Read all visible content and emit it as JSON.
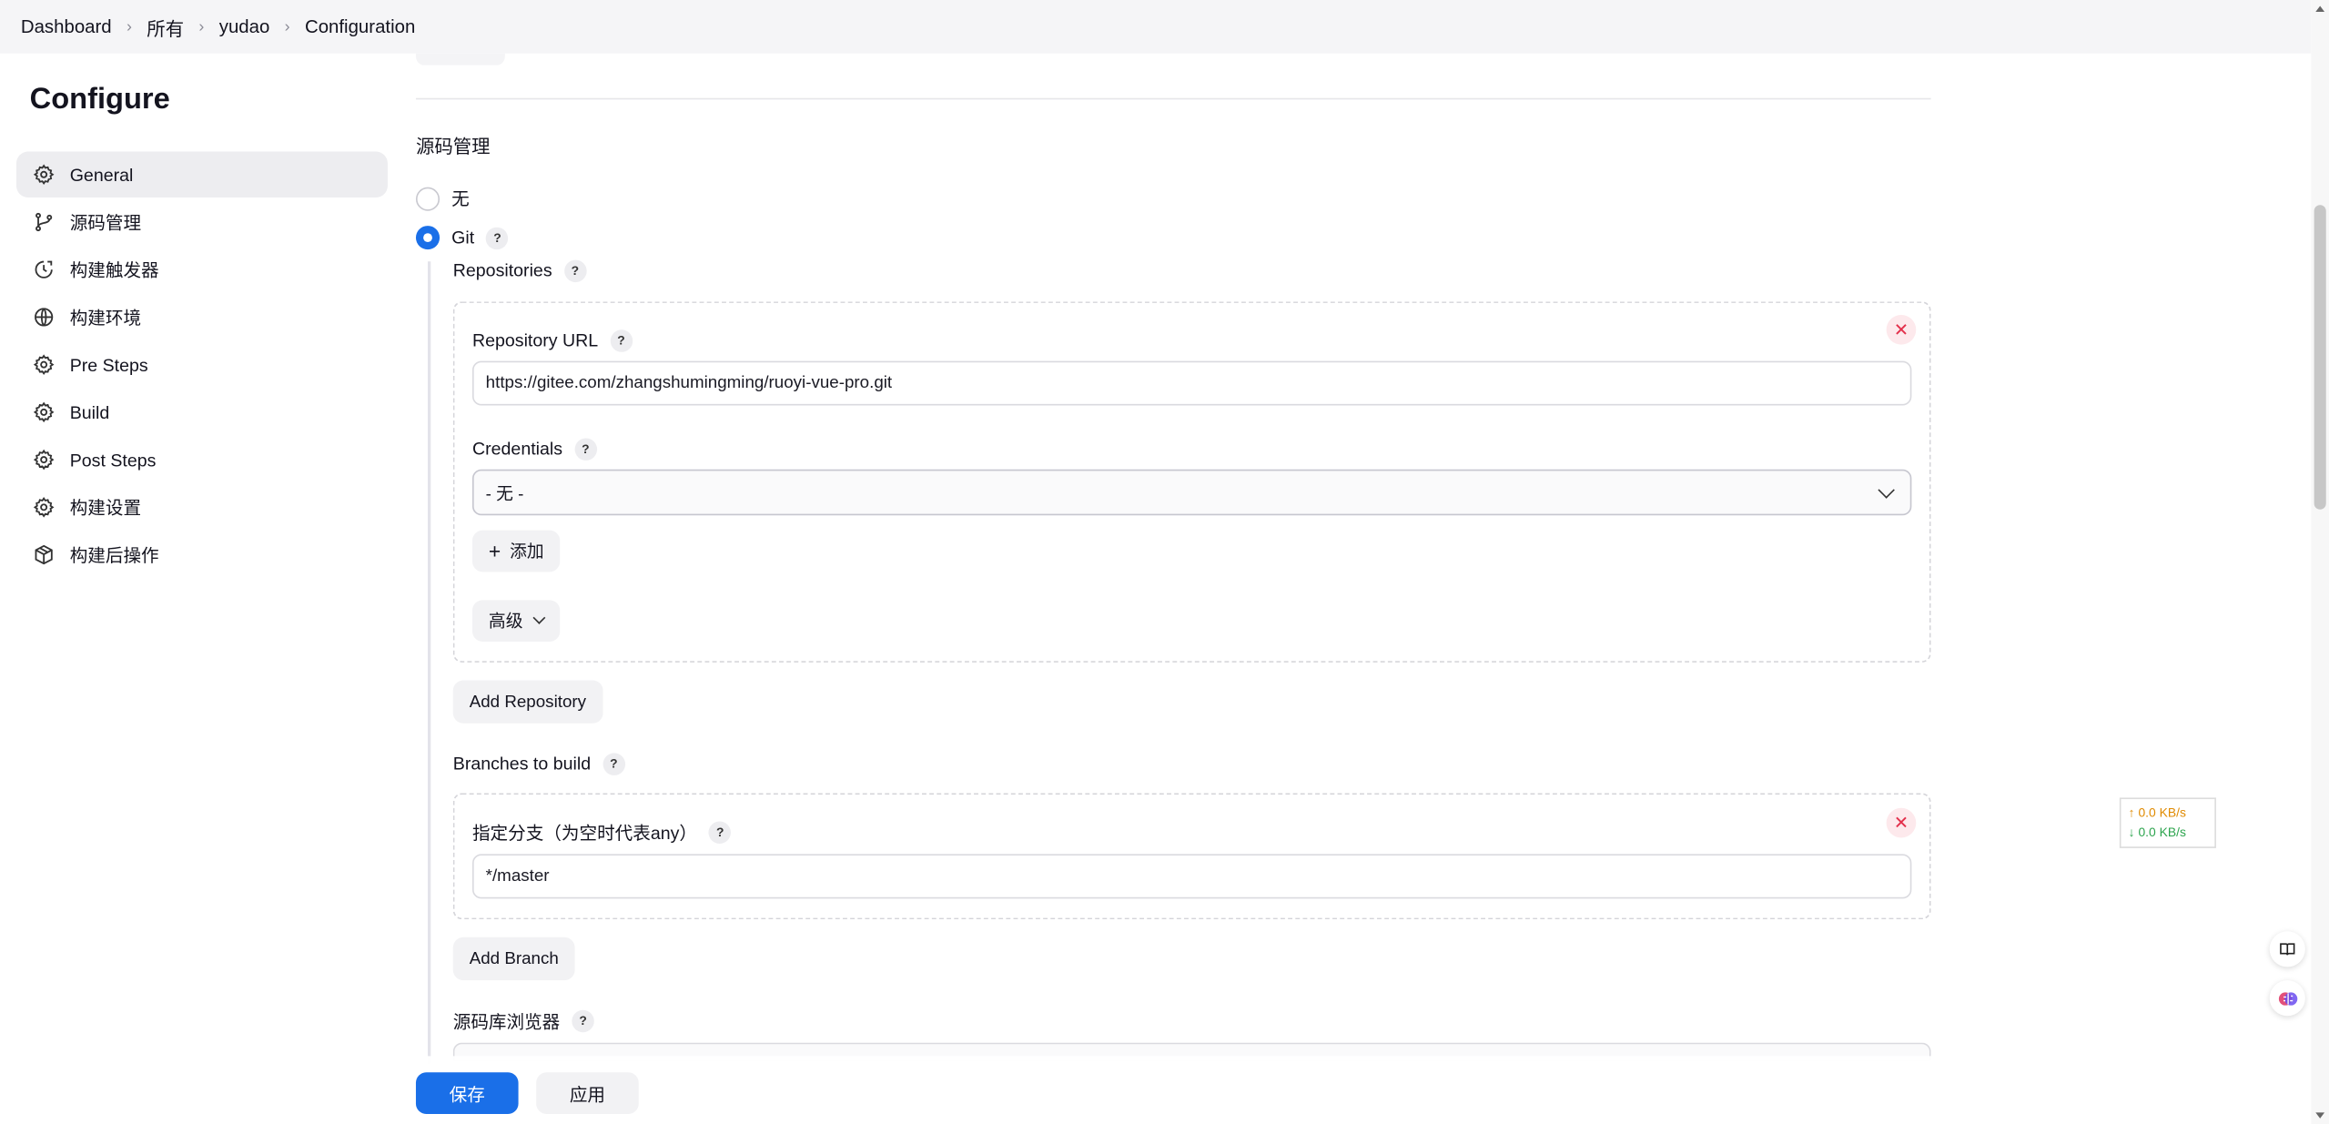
{
  "breadcrumb": [
    "Dashboard",
    "所有",
    "yudao",
    "Configuration"
  ],
  "page_title": "Configure",
  "sidebar": {
    "items": [
      {
        "label": "General",
        "icon": "gear-icon",
        "active": true
      },
      {
        "label": "源码管理",
        "icon": "git-branch-icon",
        "active": false
      },
      {
        "label": "构建触发器",
        "icon": "clock-icon",
        "active": false
      },
      {
        "label": "构建环境",
        "icon": "globe-icon",
        "active": false
      },
      {
        "label": "Pre Steps",
        "icon": "gear-icon",
        "active": false
      },
      {
        "label": "Build",
        "icon": "gear-icon",
        "active": false
      },
      {
        "label": "Post Steps",
        "icon": "gear-icon",
        "active": false
      },
      {
        "label": "构建设置",
        "icon": "gear-icon",
        "active": false
      },
      {
        "label": "构建后操作",
        "icon": "package-icon",
        "active": false
      }
    ]
  },
  "scm": {
    "section_title": "源码管理",
    "options": [
      {
        "label": "无",
        "checked": false
      },
      {
        "label": "Git",
        "checked": true
      }
    ],
    "help_mark": "?",
    "repositories_label": "Repositories",
    "repository": {
      "url_label": "Repository URL",
      "url_value": "https://gitee.com/zhangshumingming/ruoyi-vue-pro.git",
      "credentials_label": "Credentials",
      "credentials_value": "- 无 -",
      "add_label": "添加",
      "advanced_label": "高级"
    },
    "add_repository_label": "Add Repository",
    "branches_label": "Branches to build",
    "branch": {
      "label": "指定分支（为空时代表any）",
      "value": "*/master"
    },
    "add_branch_label": "Add Branch",
    "browser_label": "源码库浏览器"
  },
  "footer": {
    "save_label": "保存",
    "apply_label": "应用"
  },
  "netspeed": {
    "up": "↑ 0.0 KB/s",
    "down": "↓ 0.0 KB/s"
  },
  "colors": {
    "primary": "#1a6fe8",
    "danger": "#e3304b",
    "net_up": "#e08a00",
    "net_down": "#2da44e"
  }
}
